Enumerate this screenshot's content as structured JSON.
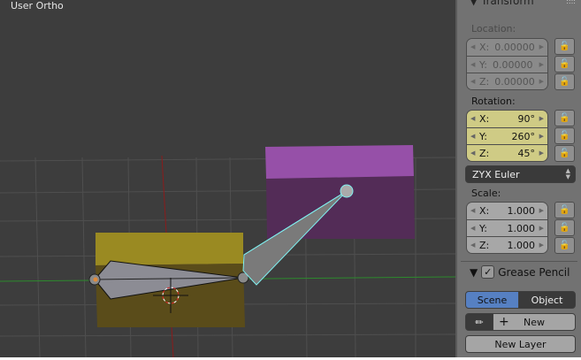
{
  "viewport": {
    "title": "User Ortho"
  },
  "panel": {
    "transform_header": "Transform",
    "location": {
      "label": "Location:",
      "x": "X:",
      "y": "Y:",
      "z": "Z:",
      "x_value": "0.00000",
      "y_value": "0.00000",
      "z_value": "0.00000"
    },
    "rotation": {
      "label": "Rotation:",
      "x": "X:",
      "y": "Y:",
      "z": "Z:",
      "x_value": "90°",
      "y_value": "260°",
      "z_value": "45°"
    },
    "rotation_mode": "ZYX Euler",
    "scale": {
      "label": "Scale:",
      "x": "X:",
      "y": "Y:",
      "z": "Z:",
      "x_value": "1.000",
      "y_value": "1.000",
      "z_value": "1.000"
    },
    "grease_pencil": {
      "header": "Grease Pencil",
      "checked": true,
      "scene": "Scene",
      "object": "Object",
      "new": "New",
      "new_layer": "New Layer"
    }
  },
  "colors": {
    "accent": "#5680c2",
    "rotation_field": "#cfcb85",
    "selected_bone": "#7ff0f0"
  }
}
